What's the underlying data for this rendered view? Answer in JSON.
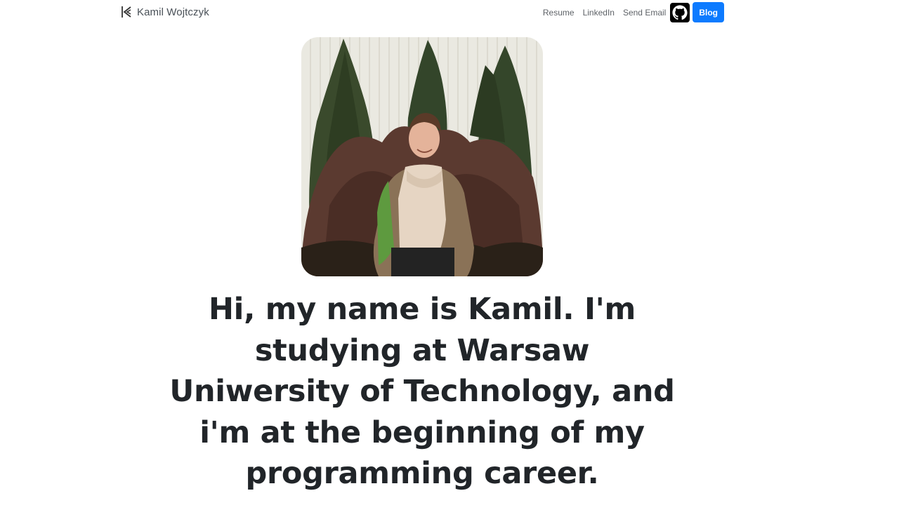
{
  "navbar": {
    "brand": {
      "logo_icon": "k-logo-icon",
      "name": "Kamil Wojtczyk"
    },
    "links": {
      "resume": "Resume",
      "linkedin": "LinkedIn",
      "send_email": "Send Email"
    },
    "github_icon": "github-icon",
    "blog_label": "Blog",
    "colors": {
      "blog_button": "#0d7bff",
      "github_button": "#000000"
    }
  },
  "hero": {
    "photo_icon": "profile-photo",
    "headline": "Hi, my name is Kamil. I'm studying at Warsaw Uniwersity of Technology, and i'm at the beginning of my programming career."
  }
}
